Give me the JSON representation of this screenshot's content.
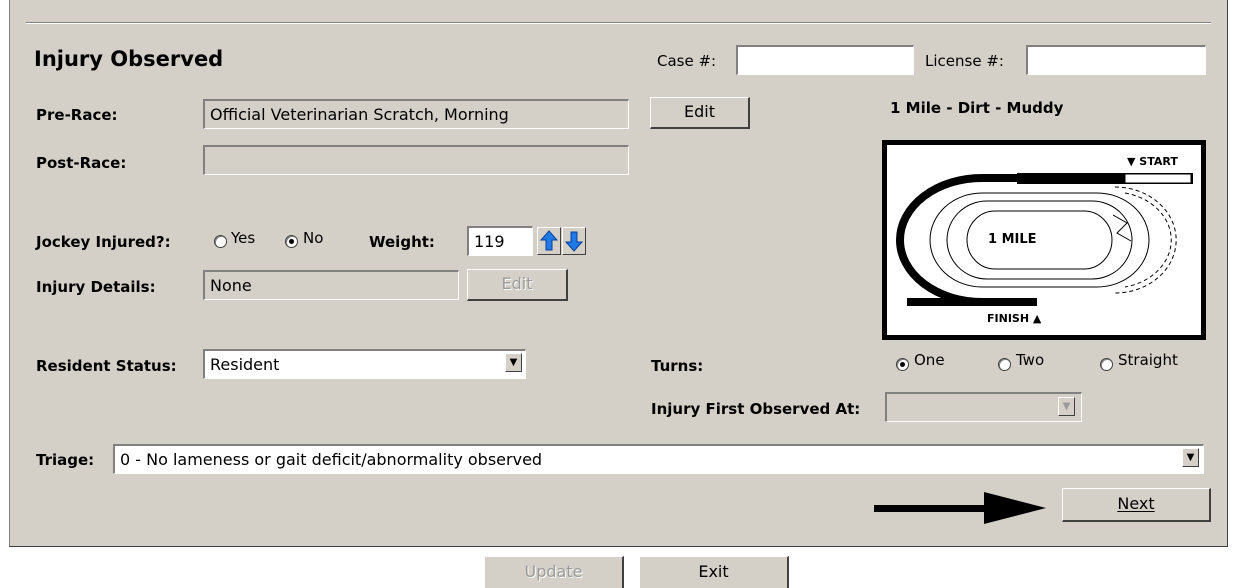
{
  "header": {
    "title": "Injury Observed",
    "case_label": "Case #:",
    "case_value": "",
    "license_label": "License #:",
    "license_value": ""
  },
  "pre_race": {
    "label": "Pre-Race:",
    "value": "Official Veterinarian Scratch, Morning",
    "edit_label": "Edit"
  },
  "post_race": {
    "label": "Post-Race:",
    "value": ""
  },
  "jockey": {
    "label": "Jockey Injured?:",
    "yes_label": "Yes",
    "no_label": "No",
    "selected": "No",
    "weight_label": "Weight:",
    "weight_value": "119"
  },
  "injury_details": {
    "label": "Injury Details:",
    "value": "None",
    "edit_label": "Edit"
  },
  "resident_status": {
    "label": "Resident Status:",
    "value": "Resident"
  },
  "track": {
    "title": "1 Mile - Dirt - Muddy",
    "distance_label": "1 MILE",
    "start_label": "▼ START",
    "finish_label": "FINISH ▲"
  },
  "turns": {
    "label": "Turns:",
    "options": [
      "One",
      "Two",
      "Straight"
    ],
    "selected": "One"
  },
  "first_observed": {
    "label": "Injury First Observed At:",
    "value": ""
  },
  "triage": {
    "label": "Triage:",
    "value": "0 - No lameness or gait deficit/abnormality observed"
  },
  "buttons": {
    "next": "Next",
    "update": "Update",
    "exit": "Exit"
  },
  "icons": {
    "weight_up": "up-arrow-icon",
    "weight_down": "down-arrow-icon",
    "pointer": "right-arrow-icon"
  },
  "colors": {
    "panel": "#d4d0c8",
    "arrow_blue": "#1f7ae6"
  }
}
